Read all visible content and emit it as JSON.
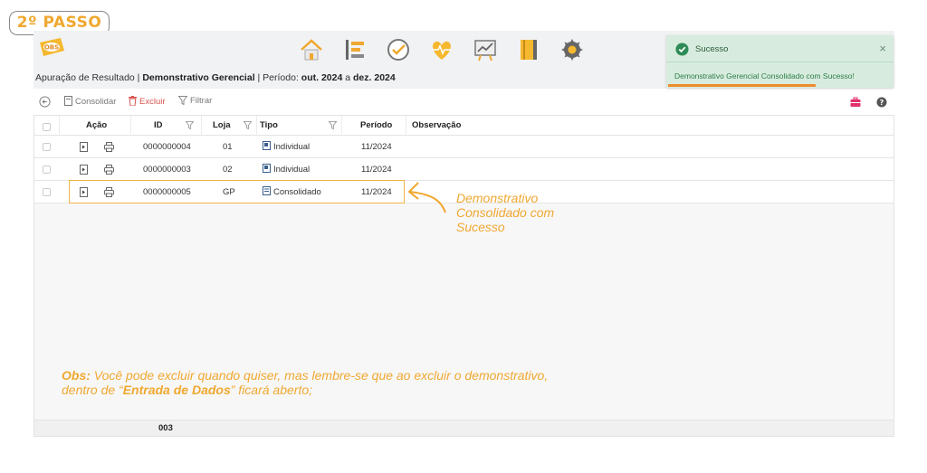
{
  "step_badge": "2º PASSO",
  "header": {
    "nav_icons": [
      "home-icon",
      "hierarchy-icon",
      "check-circle-icon",
      "heart-pulse-icon",
      "chart-board-icon",
      "notebook-icon",
      "settings-gear-icon"
    ]
  },
  "breadcrumb": {
    "part1": "Apuração de Resultado | ",
    "part2": "Demonstrativo Gerencial",
    "part3": " | Período: ",
    "period_start": "out. 2024",
    "part4": " a ",
    "period_end": "dez. 2024"
  },
  "toast": {
    "title": "Sucesso",
    "close": "×",
    "message": "Demonstrativo Gerencial Consolidado com Sucesso!",
    "progress": 0.66,
    "colors": {
      "background": "#d7ecde",
      "progress": "#ef8a2d",
      "check": "#2e8b57"
    }
  },
  "toolbar": {
    "consolidar": "Consolidar",
    "excluir": "Excluir",
    "filtrar": "Filtrar"
  },
  "grid": {
    "headers": {
      "acao": "Ação",
      "id": "ID",
      "loja": "Loja",
      "tipo": "Tipo",
      "periodo": "Período",
      "observacao": "Observação"
    },
    "rows": [
      {
        "id": "0000000004",
        "loja": "01",
        "tipo": "Individual",
        "periodo": "11/2024",
        "observacao": ""
      },
      {
        "id": "0000000003",
        "loja": "02",
        "tipo": "Individual",
        "periodo": "11/2024",
        "observacao": ""
      },
      {
        "id": "0000000005",
        "loja": "GP",
        "tipo": "Consolidado",
        "periodo": "11/2024",
        "observacao": ""
      }
    ],
    "footer_count": "003"
  },
  "annotation": {
    "text": "Demonstrativo Consolidado com Sucesso",
    "color": "#f0a830"
  },
  "obs": {
    "label": "Obs:",
    "text1": " Você pode excluir quando quiser, mas lembre-se que ao excluir o demonstrativo, dentro de “",
    "emphasis": "Entrada de Dados",
    "text2": "” ficará aberto;"
  }
}
